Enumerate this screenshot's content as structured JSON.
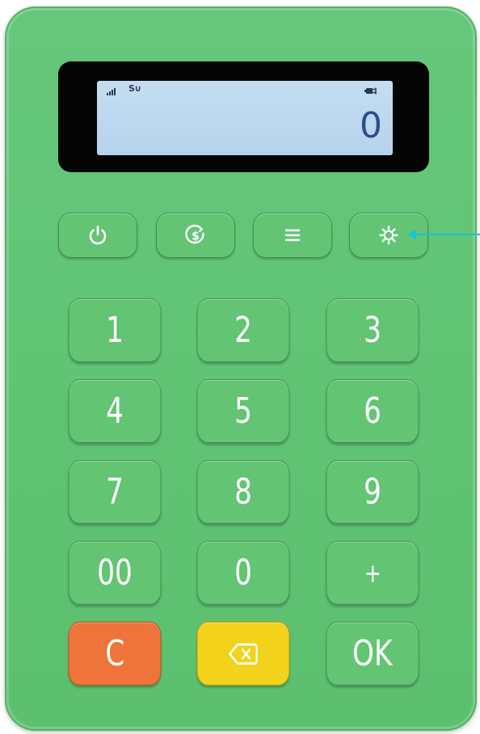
{
  "display": {
    "amount": "0",
    "network_label": "S∪",
    "signal_icon": "signal-bars-icon",
    "battery_icon": "battery-charging-icon"
  },
  "function_keys": [
    {
      "icon": "power-icon"
    },
    {
      "icon": "dollar-coin-icon"
    },
    {
      "icon": "menu-icon"
    },
    {
      "icon": "settings-gear-icon"
    }
  ],
  "keypad": {
    "k1": "1",
    "k2": "2",
    "k3": "3",
    "k4": "4",
    "k5": "5",
    "k6": "6",
    "k7": "7",
    "k8": "8",
    "k9": "9",
    "k00": "00",
    "k0": "0",
    "kplus": "+",
    "clear": "C",
    "backspace_icon": "backspace-icon",
    "ok": "OK"
  },
  "colors": {
    "body": "#5fc272",
    "lcd_digit": "#2c4d8c",
    "clear_key": "#ee7439",
    "backspace_key": "#f2d21a",
    "annotation_arrow": "#19c4d8"
  }
}
